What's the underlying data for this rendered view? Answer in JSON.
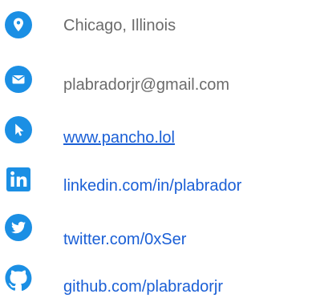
{
  "contacts": {
    "location": {
      "text": "Chicago, Illinois",
      "icon": "location-pin-icon"
    },
    "email": {
      "text": "plabradorjr@gmail.com",
      "icon": "envelope-icon"
    },
    "website": {
      "text": "www.pancho.lol",
      "icon": "cursor-arrow-icon"
    },
    "linkedin": {
      "text": "linkedin.com/in/plabrador",
      "icon": "linkedin-icon"
    },
    "twitter": {
      "text": "twitter.com/0xSer",
      "icon": "twitter-icon"
    },
    "github": {
      "text": "github.com/plabradorjr",
      "icon": "github-icon"
    }
  },
  "colors": {
    "icon_blue": "#1b8fe4",
    "link_blue": "#1a5fd6",
    "static_gray": "#6b6b6b"
  }
}
